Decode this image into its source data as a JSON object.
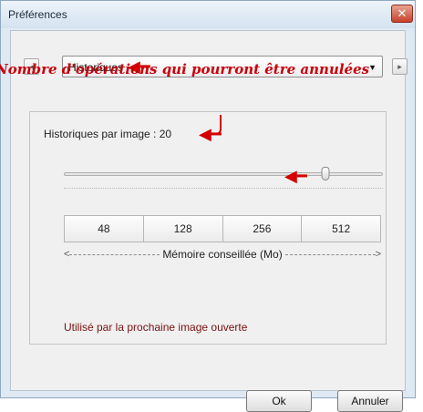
{
  "window": {
    "title": "Préférences",
    "close_glyph": "✕"
  },
  "nav": {
    "prev_glyph": "◂",
    "next_glyph": "▸"
  },
  "combo": {
    "selected": "Historiques",
    "arrow": "▼"
  },
  "annotation": {
    "text": "Nombre d'opérations qui pourront être annulées",
    "arrow_glyph": "◀━",
    "color": "#c8000a"
  },
  "history": {
    "label": "Historiques par image : 20",
    "value": 20,
    "slider_fraction": 0.82
  },
  "memory": {
    "options": [
      "48",
      "128",
      "256",
      "512"
    ],
    "caption": "Mémoire conseillée (Mo)",
    "left_caret": "<",
    "right_caret": ">"
  },
  "footnote": "Utilisé par la prochaine image ouverte",
  "buttons": {
    "ok": "Ok",
    "cancel": "Annuler"
  }
}
